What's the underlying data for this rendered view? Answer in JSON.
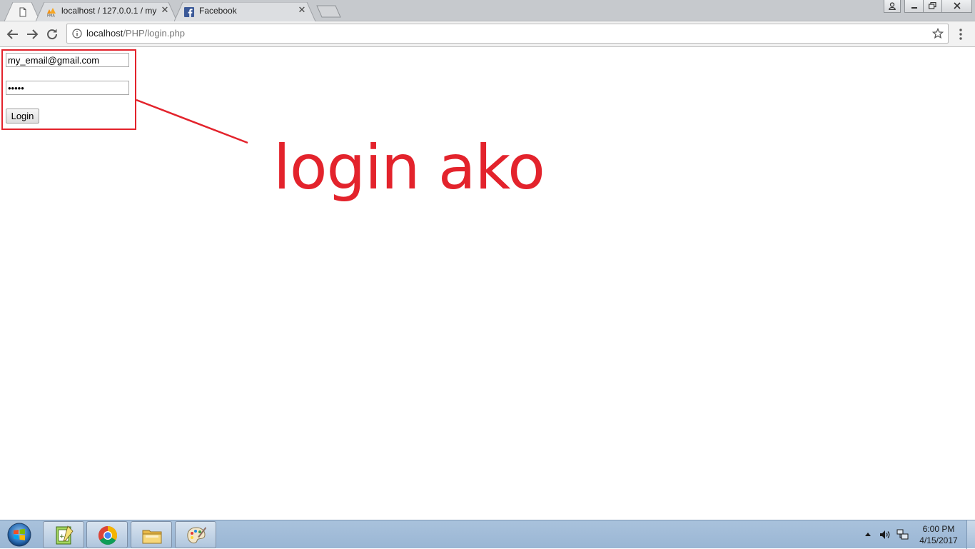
{
  "browser": {
    "tabs": [
      {
        "title": "",
        "active": true,
        "favicon": "page-icon"
      },
      {
        "title": "localhost / 127.0.0.1 / my",
        "active": false,
        "favicon": "phpmyadmin-icon"
      },
      {
        "title": "Facebook",
        "active": false,
        "favicon": "facebook-icon"
      }
    ],
    "close_glyph": "✕",
    "address": {
      "host": "localhost",
      "path": "/PHP/login.php"
    }
  },
  "page": {
    "email_value": "my_email@gmail.com",
    "password_mask": "•••••",
    "login_label": "Login",
    "annotation": "login ako",
    "annotation_color": "#e3232c"
  },
  "taskbar": {
    "apps": [
      "notepad-plus-icon",
      "chrome-icon",
      "file-explorer-icon",
      "paint-icon"
    ],
    "time": "6:00 PM",
    "date": "4/15/2017"
  }
}
